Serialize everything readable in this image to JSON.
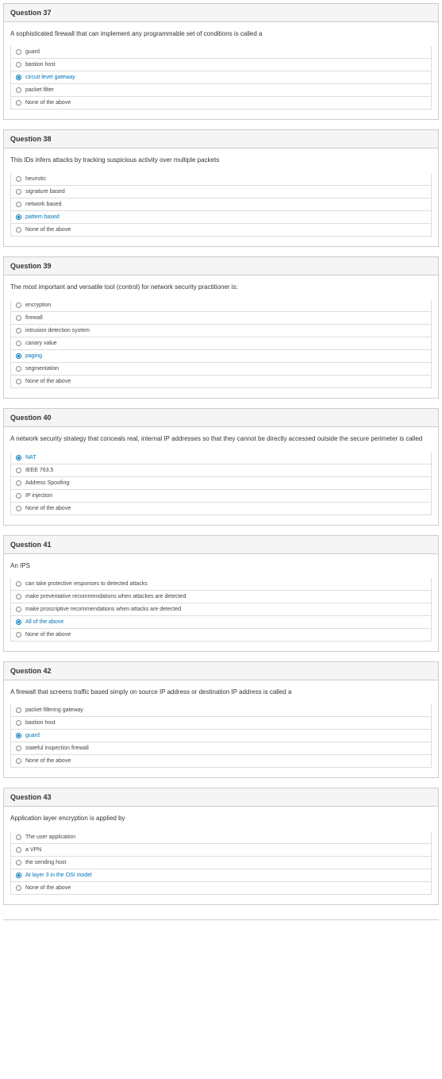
{
  "questions": [
    {
      "number": "Question 37",
      "prompt": "A sophisticated firewall that can implement any programmable set of conditions is called a",
      "options": [
        {
          "label": "guard",
          "selected": false
        },
        {
          "label": "bastion host",
          "selected": false
        },
        {
          "label": "circuit level gateway",
          "selected": true
        },
        {
          "label": "packet filter",
          "selected": false
        },
        {
          "label": "None of the above",
          "selected": false
        }
      ]
    },
    {
      "number": "Question 38",
      "prompt": "This IDs infers attacks by tracking suspicious activity over multiple packets",
      "options": [
        {
          "label": "heuristic",
          "selected": false
        },
        {
          "label": "signature based",
          "selected": false
        },
        {
          "label": "network based",
          "selected": false
        },
        {
          "label": "pattern based",
          "selected": true
        },
        {
          "label": "None of the above",
          "selected": false
        }
      ]
    },
    {
      "number": "Question 39",
      "prompt": "The most important and versatile tool (control) for network security practitioner is:",
      "options": [
        {
          "label": "encryption",
          "selected": false
        },
        {
          "label": "firewall",
          "selected": false
        },
        {
          "label": "intrusion detection system",
          "selected": false
        },
        {
          "label": "canary value",
          "selected": false
        },
        {
          "label": "paging",
          "selected": true
        },
        {
          "label": "segmentation",
          "selected": false
        },
        {
          "label": "None of the above",
          "selected": false
        }
      ]
    },
    {
      "number": "Question 40",
      "prompt": "A network security strategy that conceals real, internal IP addresses so that they cannot be directly accessed outside the secure perimeter is called",
      "options": [
        {
          "label": "NAT",
          "selected": true
        },
        {
          "label": "IEEE 763.5",
          "selected": false
        },
        {
          "label": "Address Spoofing",
          "selected": false
        },
        {
          "label": "IP injection",
          "selected": false
        },
        {
          "label": "None of the above",
          "selected": false
        }
      ]
    },
    {
      "number": "Question 41",
      "prompt": "An IPS",
      "options": [
        {
          "label": "can take protective responses to detected attacks",
          "selected": false
        },
        {
          "label": "make preventative recommendations when attackes are detected",
          "selected": false
        },
        {
          "label": "make proscriptive recommendations when attacks are detected",
          "selected": false
        },
        {
          "label": "All of the above",
          "selected": true
        },
        {
          "label": "None of the above",
          "selected": false
        }
      ]
    },
    {
      "number": "Question 42",
      "prompt": "A firewall that screens traffic based simply on source IP address or destination IP address is called a",
      "options": [
        {
          "label": "packet fillering gateway",
          "selected": false
        },
        {
          "label": "bastion host",
          "selected": false
        },
        {
          "label": "guard",
          "selected": true
        },
        {
          "label": "stateful inspection firewall",
          "selected": false
        },
        {
          "label": "None of the above",
          "selected": false
        }
      ]
    },
    {
      "number": "Question 43",
      "prompt": "Application layer encryption is applied by",
      "options": [
        {
          "label": "The user application",
          "selected": false
        },
        {
          "label": "a VPN",
          "selected": false
        },
        {
          "label": "the sending host",
          "selected": false
        },
        {
          "label": "At layer 3 in the OSI model",
          "selected": true
        },
        {
          "label": "None of the above",
          "selected": false
        }
      ]
    }
  ]
}
